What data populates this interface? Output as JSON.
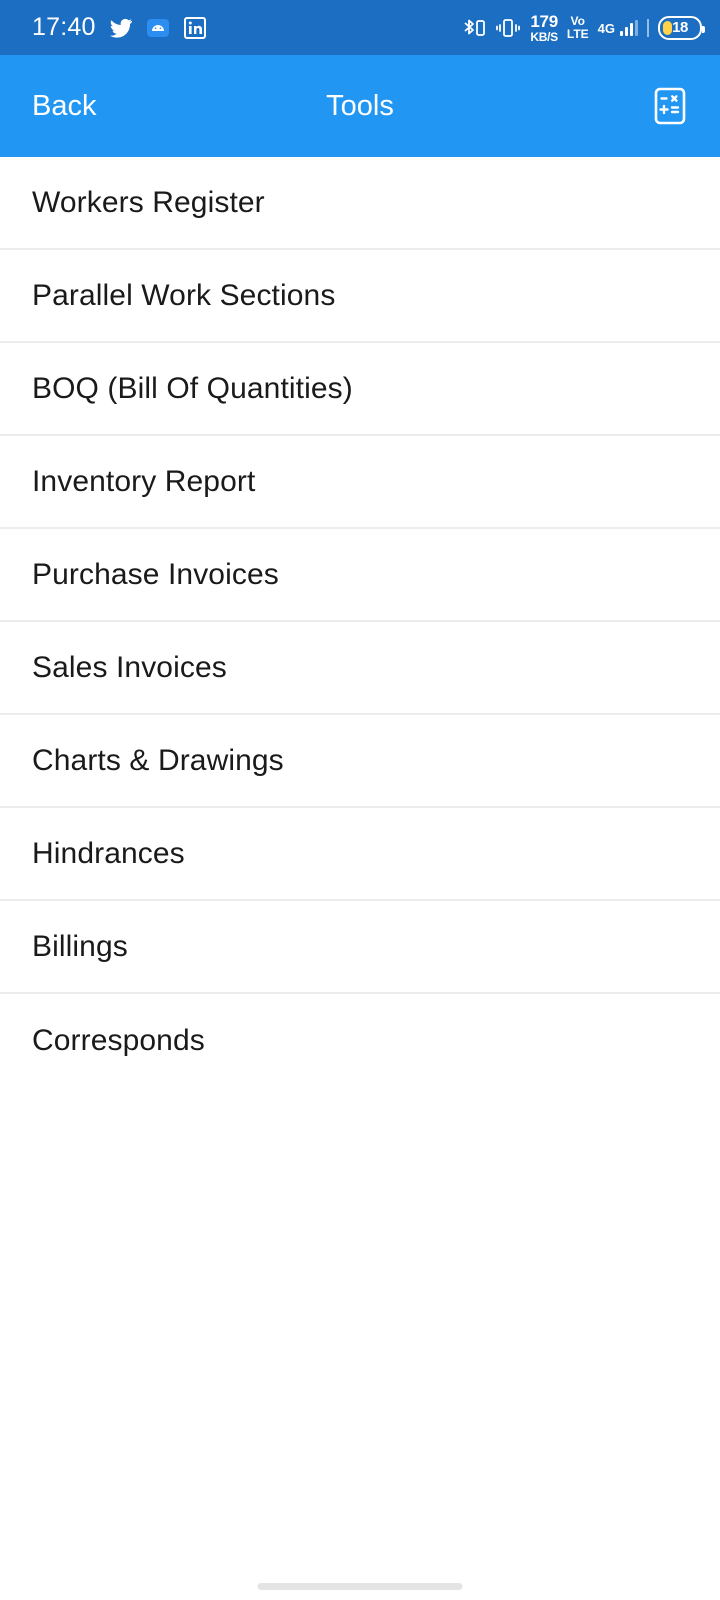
{
  "status_bar": {
    "time": "17:40",
    "notification_icons": [
      "twitter-icon",
      "android-app-icon",
      "linkedin-icon"
    ],
    "bluetooth_icon": "bluetooth-device-icon",
    "vibrate_icon": "vibrate-mode-icon",
    "network_speed_value": "179",
    "network_speed_unit": "KB/S",
    "volte_line1": "Vo",
    "volte_line2": "LTE",
    "network_type": "4G",
    "signal_icon": "signal-bars-icon",
    "battery_percent": "18",
    "background_color": "#1b6ec2"
  },
  "app_bar": {
    "back_label": "Back",
    "title": "Tools",
    "action_icon": "calculator-icon",
    "background_color": "#2196f3"
  },
  "tools": {
    "items": [
      {
        "label": "Workers Register"
      },
      {
        "label": "Parallel Work Sections"
      },
      {
        "label": "BOQ (Bill Of Quantities)"
      },
      {
        "label": "Inventory Report"
      },
      {
        "label": "Purchase Invoices"
      },
      {
        "label": "Sales Invoices"
      },
      {
        "label": "Charts & Drawings"
      },
      {
        "label": "Hindrances"
      },
      {
        "label": "Billings"
      },
      {
        "label": "Corresponds"
      }
    ]
  },
  "colors": {
    "accent": "#2196f3",
    "status_bar": "#1b6ec2",
    "divider": "#ececec",
    "text": "#1a1a1a"
  }
}
